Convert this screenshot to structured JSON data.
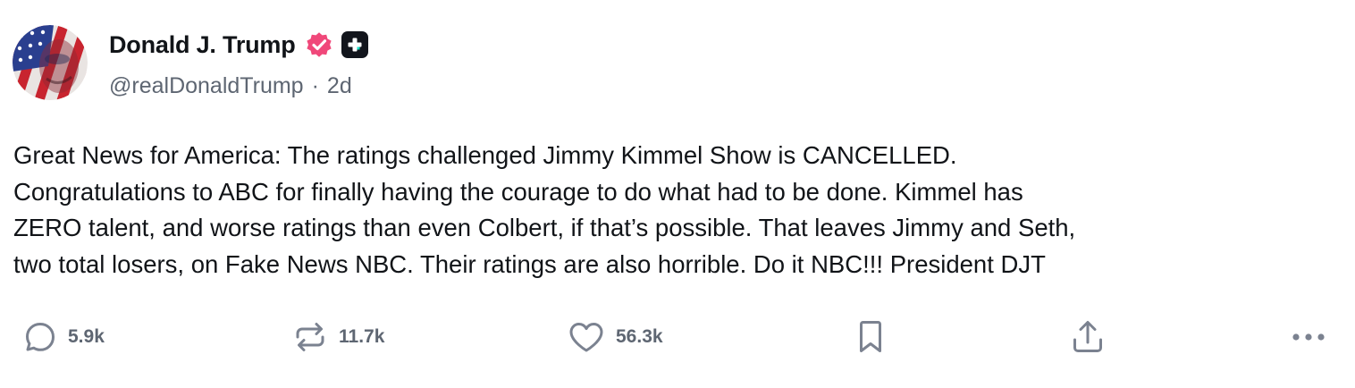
{
  "post": {
    "author": {
      "display_name": "Donald J. Trump",
      "handle": "@realDonaldTrump",
      "separator": "·",
      "time_ago": "2d",
      "verified_icon": "verified-badge-icon",
      "badge_icon": "plus-badge-icon"
    },
    "text": "Great News for America: The ratings challenged Jimmy Kimmel Show is CANCELLED.\nCongratulations to ABC for finally having the courage to do what had to be done. Kimmel has\nZERO talent, and worse ratings than even Colbert, if that’s possible. That leaves Jimmy and Seth,\ntwo total losers, on Fake News NBC. Their ratings are also horrible. Do it NBC!!! President DJT",
    "actions": {
      "replies": "5.9k",
      "reposts": "11.7k",
      "likes": "56.3k"
    }
  },
  "colors": {
    "text": "#111418",
    "muted": "#5e6672",
    "icon": "#7b8290",
    "verified": "#f0487a",
    "badge_bg": "#12151c",
    "badge_accent": "#18e0c8"
  }
}
